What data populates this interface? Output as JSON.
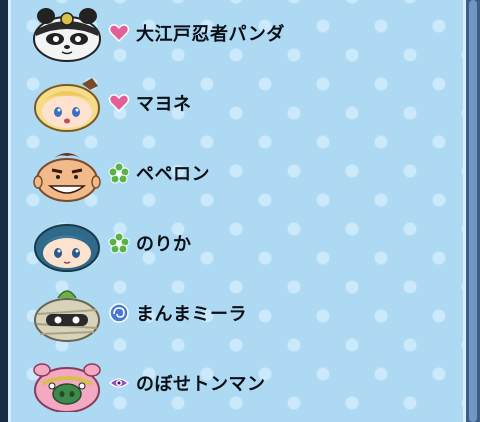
{
  "list": {
    "items": [
      {
        "name": "大江戸忍者パンダ",
        "avatar_icon": "ninja-panda-icon",
        "tribe_icon": "heart-icon",
        "tribe_color": "#e25f97"
      },
      {
        "name": "マヨネ",
        "avatar_icon": "blonde-girl-icon",
        "tribe_icon": "heart-icon",
        "tribe_color": "#e25f97"
      },
      {
        "name": "ペペロン",
        "avatar_icon": "grinning-man-icon",
        "tribe_icon": "flower-icon",
        "tribe_color": "#59b34a"
      },
      {
        "name": "のりか",
        "avatar_icon": "blue-hair-girl-icon",
        "tribe_icon": "flower-icon",
        "tribe_color": "#59b34a"
      },
      {
        "name": "まんまミーラ",
        "avatar_icon": "mummy-icon",
        "tribe_icon": "swirl-icon",
        "tribe_color": "#4a79d1"
      },
      {
        "name": "のぼせトンマン",
        "avatar_icon": "pink-pig-icon",
        "tribe_icon": "eye-icon",
        "tribe_color": "#8f4fc7"
      }
    ]
  },
  "colors": {
    "panel": "#aed9f2",
    "scrollbar": "#3a5e86"
  }
}
